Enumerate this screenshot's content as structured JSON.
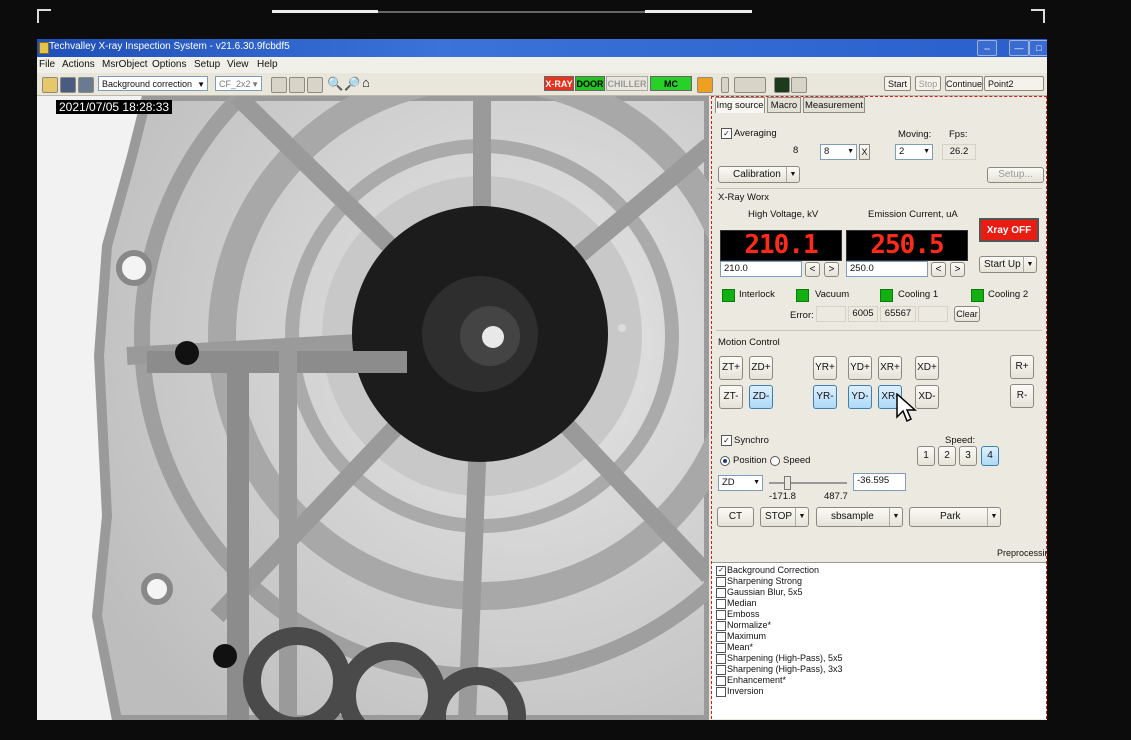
{
  "window": {
    "title": "Techvalley X-ray Inspection System - v21.6.30.9fcbdf5",
    "controls": [
      "⇔",
      "—",
      "□"
    ]
  },
  "menu": [
    "File",
    "Actions",
    "MsrObject",
    "Options",
    "Setup",
    "View",
    "Help"
  ],
  "toolbar": {
    "filter_combo": "Background correction",
    "binning_combo": "CF_2x2",
    "status": {
      "xray": "X-RAY",
      "door": "DOOR",
      "chiller": "CHILLER",
      "mc": "MC"
    },
    "start": "Start",
    "stop": "Stop",
    "continue": "Continue",
    "point": "Point2"
  },
  "image": {
    "timestamp": "2021/07/05 18:28:33"
  },
  "tabs": [
    "Img source",
    "Macro",
    "Measurement"
  ],
  "source": {
    "averaging_label": "Averaging",
    "averaging_value": "8",
    "averaging_combo": "8",
    "x_button": "X",
    "moving_label": "Moving:",
    "moving_value": "2",
    "fps_label": "Fps:",
    "fps_value": "26.2",
    "calibration": "Calibration",
    "setup": "Setup..."
  },
  "xray": {
    "section": "X-Ray Worx",
    "hv_label": "High Voltage, kV",
    "current_label": "Emission Current, uA",
    "hv_display": "210.1",
    "current_display": "250.5",
    "hv_set": "210.0",
    "current_set": "250.0",
    "xray_off": "Xray OFF",
    "start_up": "Start Up",
    "interlock": "Interlock",
    "vacuum": "Vacuum",
    "cooling1": "Cooling 1",
    "cooling2": "Cooling 2",
    "error_label": "Error:",
    "error_code1": "6005",
    "error_code2": "65567",
    "clear": "Clear"
  },
  "motion": {
    "section": "Motion Control",
    "zt_plus": "ZT+",
    "zd_plus": "ZD+",
    "yr_plus": "YR+",
    "yd_plus": "YD+",
    "xr_plus": "XR+",
    "xd_plus": "XD+",
    "r_plus": "R+",
    "zt_minus": "ZT-",
    "zd_minus": "ZD-",
    "yr_minus": "YR-",
    "yd_minus": "YD-",
    "xr_minus": "XR-",
    "xd_minus": "XD-",
    "r_minus": "R-",
    "synchro": "Synchro",
    "speed_label": "Speed:",
    "position": "Position",
    "speed": "Speed",
    "speeds": [
      "1",
      "2",
      "3",
      "4"
    ],
    "axis_combo": "ZD",
    "range_min": "-171.8",
    "range_max": "487.7",
    "axis_value": "-36.595",
    "ct": "CT",
    "stop": "STOP",
    "sample_combo": "sbsample",
    "park": "Park"
  },
  "preprocessing": {
    "label": "Preprocessin",
    "items": [
      {
        "label": "Background Correction",
        "checked": true
      },
      {
        "label": "Sharpening Strong",
        "checked": false
      },
      {
        "label": "Gaussian Blur, 5x5",
        "checked": false
      },
      {
        "label": "Median",
        "checked": false
      },
      {
        "label": "Emboss",
        "checked": false
      },
      {
        "label": "Normalize*",
        "checked": false
      },
      {
        "label": "Maximum",
        "checked": false
      },
      {
        "label": "Mean*",
        "checked": false
      },
      {
        "label": "Sharpening (High-Pass), 5x5",
        "checked": false
      },
      {
        "label": "Sharpening (High-Pass), 3x3",
        "checked": false
      },
      {
        "label": "Enhancement*",
        "checked": false
      },
      {
        "label": "Inversion",
        "checked": false
      }
    ]
  },
  "colors": {
    "xray_status": "#e8321e",
    "door_status": "#22c322",
    "mc_status": "#27d127",
    "led_text": "#ff2a1a",
    "ok_indicator": "#13b013",
    "xray_off_button": "#e81c12"
  }
}
